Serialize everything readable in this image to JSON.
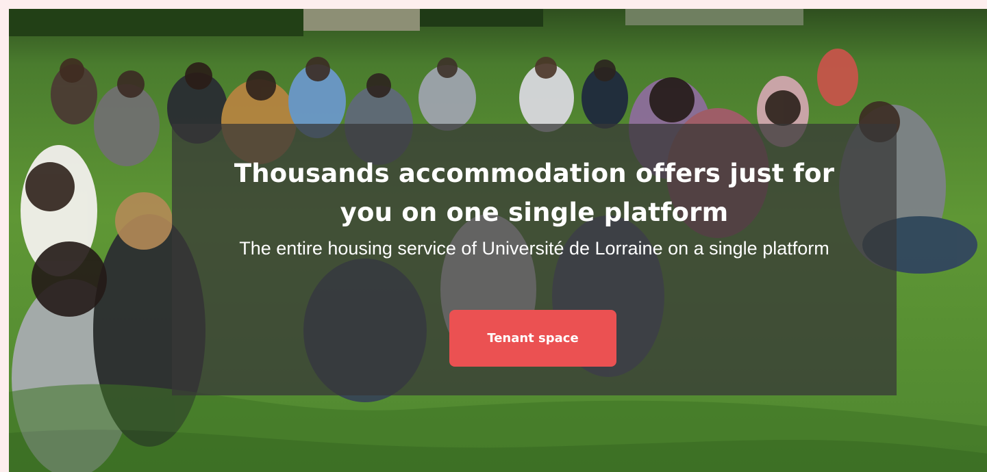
{
  "hero": {
    "title": "Thousands accommodation offers just for you on one single platform",
    "subtitle": "The entire housing service of Université de Lorraine on a single platform",
    "cta_label": "Tenant space",
    "cta_color": "#eb5152"
  },
  "background": {
    "scene": "students-on-lawn-photo"
  }
}
